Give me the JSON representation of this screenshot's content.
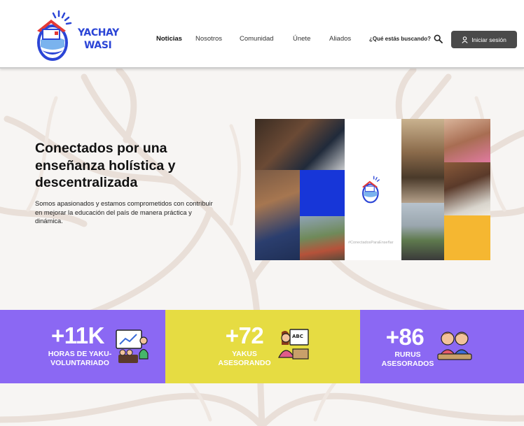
{
  "brand": {
    "line1": "YACHAY",
    "line2": "WASI"
  },
  "nav": {
    "items": [
      "Noticias",
      "Nosotros",
      "Comunidad",
      "Únete",
      "Aliados"
    ],
    "search_label": "¿Qué estás buscando?",
    "login_label": "Iniciar sesión"
  },
  "hero": {
    "title": "Conectados por una enseñanza holística y descentralizada",
    "description": "Somos apasionados y estamos comprometidos con contribuir en mejorar la educación del país de manera práctica y dinámica.",
    "hashtag": "#ConectadosParaEnseñar"
  },
  "stats": [
    {
      "value": "+11K",
      "label": "HORAS DE YAKU-VOLUNTARIADO",
      "color": "#8b68f3"
    },
    {
      "value": "+72",
      "label": "YAKUS ASESORANDO",
      "color": "#e6dc42"
    },
    {
      "value": "+86",
      "label": "RURUS ASESORADOS",
      "color": "#8b68f3"
    }
  ],
  "colors": {
    "brand_blue": "#2b45d6",
    "purple": "#8b68f3",
    "yellow": "#e6dc42",
    "tile_blue": "#1736d8",
    "tile_orange": "#f5b731",
    "button": "#4a4a4a"
  },
  "icons": [
    "logo-house-icon",
    "search-icon",
    "user-icon",
    "teacher-board-icon",
    "teacher-abc-icon",
    "students-icon"
  ]
}
